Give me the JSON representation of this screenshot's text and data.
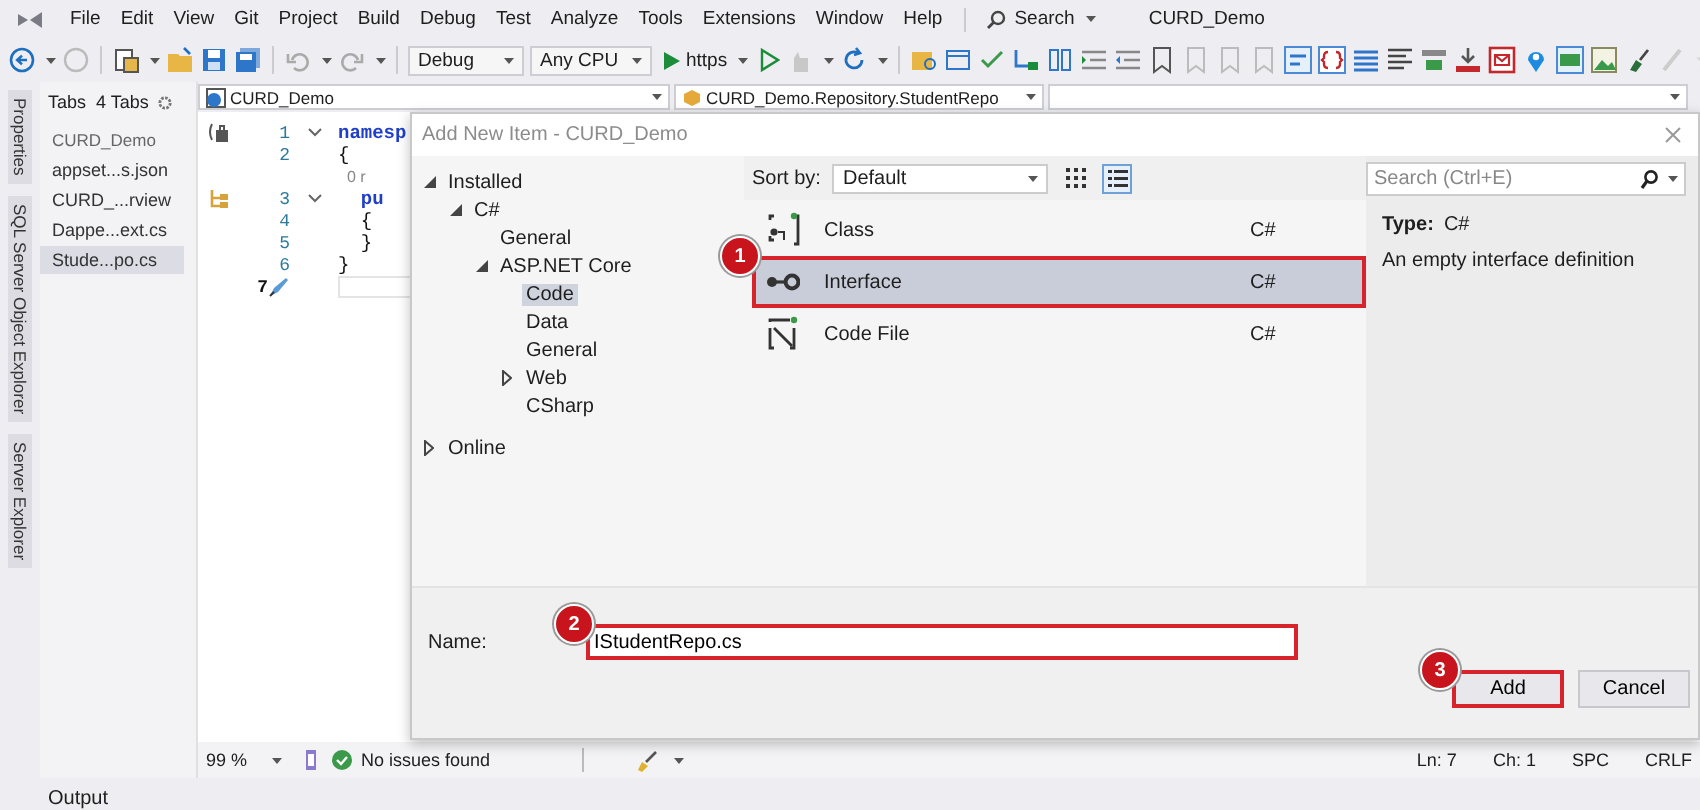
{
  "menu_bar": {
    "items": [
      "File",
      "Edit",
      "View",
      "Git",
      "Project",
      "Build",
      "Debug",
      "Test",
      "Analyze",
      "Tools",
      "Extensions",
      "Window",
      "Help"
    ],
    "search": "Search",
    "solution_title": "CURD_Demo"
  },
  "toolbar": {
    "configuration": "Debug",
    "platform": "Any CPU",
    "run_target": "https"
  },
  "side_tabs": [
    "Properties",
    "SQL Server Object Explorer",
    "Server Explorer"
  ],
  "tabs_panel": {
    "title": "Tabs",
    "count": "4 Tabs",
    "group": "CURD_Demo",
    "items": [
      {
        "label": "appset...s.json",
        "selected": false
      },
      {
        "label": "CURD_...rview",
        "selected": false
      },
      {
        "label": "Dappe...ext.cs",
        "selected": false
      },
      {
        "label": "Stude...po.cs",
        "selected": true
      }
    ]
  },
  "editor": {
    "project": "CURD_Demo",
    "type_path": "CURD_Demo.Repository.StudentRepo",
    "lines": [
      {
        "kind": "keyword",
        "number": "1",
        "text": "namesp",
        "fold": true,
        "current": false,
        "quick_actions": true,
        "inherits": false
      },
      {
        "kind": "punct",
        "number": "2",
        "text": "{",
        "fold": false,
        "current": false,
        "quick_actions": false,
        "inherits": false
      },
      {
        "kind": "lens",
        "text": "  0 r"
      },
      {
        "kind": "keyword",
        "number": "3",
        "text": "  pu",
        "fold": true,
        "current": false,
        "quick_actions": false,
        "inherits": true
      },
      {
        "kind": "punct",
        "number": "4",
        "text": "  {",
        "fold": false,
        "current": false,
        "quick_actions": false,
        "inherits": false
      },
      {
        "kind": "punct",
        "number": "5",
        "text": "  }",
        "fold": false,
        "current": false,
        "quick_actions": false,
        "inherits": false
      },
      {
        "kind": "punct",
        "number": "6",
        "text": "}",
        "fold": false,
        "current": false,
        "quick_actions": false,
        "inherits": false
      },
      {
        "number": "7",
        "fold": false,
        "current": true,
        "quick_actions": false,
        "inherits": false
      }
    ],
    "status": {
      "zoom": "99 %",
      "issues": "No issues found",
      "line": "Ln: 7",
      "column": "Ch: 1",
      "indent": "SPC",
      "line_ending": "CRLF"
    }
  },
  "output_tab": "Output",
  "dialog": {
    "title": "Add New Item - CURD_Demo",
    "tree": [
      {
        "label": "Installed",
        "expanded": true,
        "selected": false,
        "children": [
          {
            "label": "C#",
            "expanded": true,
            "selected": false,
            "children": [
              {
                "label": "General",
                "selected": false
              },
              {
                "label": "ASP.NET Core",
                "expanded": true,
                "selected": false,
                "children": [
                  {
                    "label": "Code",
                    "selected": true
                  },
                  {
                    "label": "Data",
                    "selected": false
                  },
                  {
                    "label": "General",
                    "selected": false
                  },
                  {
                    "label": "Web",
                    "expanded": false,
                    "selected": false
                  },
                  {
                    "label": "CSharp",
                    "selected": false
                  }
                ]
              }
            ]
          }
        ]
      },
      {
        "label": "Online",
        "expanded": false,
        "selected": false
      }
    ],
    "sort_label": "Sort by:",
    "sort_value": "Default",
    "views": [
      {
        "kind": "grid",
        "selected": false
      },
      {
        "kind": "list",
        "selected": true
      }
    ],
    "templates": [
      {
        "kind": "class",
        "name": "Class",
        "language": "C#",
        "selected": false
      },
      {
        "kind": "interface",
        "name": "Interface",
        "language": "C#",
        "selected": true,
        "step": "1"
      },
      {
        "kind": "code-file",
        "name": "Code File",
        "language": "C#",
        "selected": false
      }
    ],
    "search_placeholder": "Search (Ctrl+E)",
    "details": {
      "type_label": "Type:",
      "type_value": "C#",
      "description": "An empty interface definition"
    },
    "name_label": "Name:",
    "name_field": {
      "value": "IStudentRepo.cs",
      "step": "2"
    },
    "buttons": [
      {
        "label": "Add",
        "step": "3"
      },
      {
        "label": "Cancel"
      }
    ]
  }
}
